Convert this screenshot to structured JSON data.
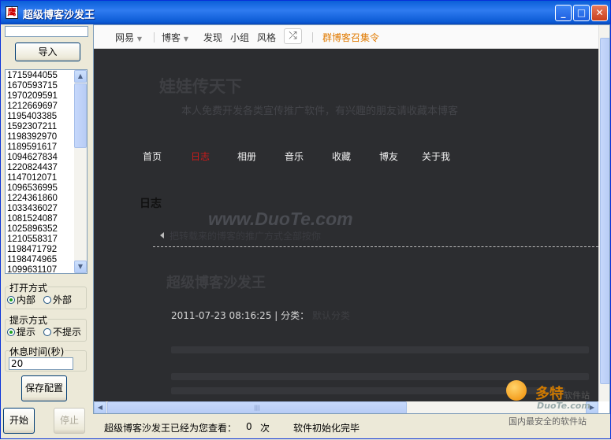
{
  "window": {
    "title": "超级博客沙发王",
    "icon_glyph": "鹰"
  },
  "left": {
    "import_button": "导入",
    "ids": [
      "1715944055",
      "1670593715",
      "1970209591",
      "1212669697",
      "1195403385",
      "1592307211",
      "1198392970",
      "1189591617",
      "1094627834",
      "1220824437",
      "1147012071",
      "1096536995",
      "1224361860",
      "1033436027",
      "1081524087",
      "1025896352",
      "1210558317",
      "1198471792",
      "1198474965",
      "1099631107"
    ],
    "open_mode": {
      "label": "打开方式",
      "options": [
        "内部",
        "外部"
      ],
      "selected": "内部"
    },
    "prompt_mode": {
      "label": "提示方式",
      "options": [
        "提示",
        "不提示"
      ],
      "selected": "提示"
    },
    "rest_time": {
      "label": "休息时间(秒)",
      "value": "20"
    },
    "save_button": "保存配置",
    "start_button": "开始",
    "stop_button": "停止"
  },
  "browser": {
    "nav": {
      "netease": "网易",
      "blog": "博客",
      "discover": "发现",
      "group": "小组",
      "style": "风格",
      "recruit": "群博客召集令"
    },
    "blog": {
      "title": "娃娃传天下",
      "subtitle": "本人免费开发各类宣传推广软件，有兴趣的朋友请收藏本博客",
      "menu": [
        "首页",
        "日志",
        "相册",
        "音乐",
        "收藏",
        "博友",
        "关于我"
      ],
      "active_menu": "日志",
      "section_heading": "日志",
      "watermark": "www.DuoTe.com",
      "prev_post": "把转载来的博客的推广方式全部按你",
      "post_title": "超级博客沙发王",
      "post_date": "2011-07-23 08:16:25",
      "post_category_label": "分类：",
      "post_category": "默认分类"
    }
  },
  "status": {
    "visited_label": "超级博客沙发王已经为您查看：",
    "visited_count": "0",
    "visited_unit": "次",
    "message": "软件初始化完毕"
  },
  "logo": {
    "name": "多特",
    "suffix": "软件站",
    "url": "DuoTe.com",
    "slogan": "国内最安全的软件站"
  },
  "colors": {
    "active_menu": "#cc1a1a",
    "recruit_link": "#e07a00",
    "blog_bg": "#2c2d30"
  }
}
